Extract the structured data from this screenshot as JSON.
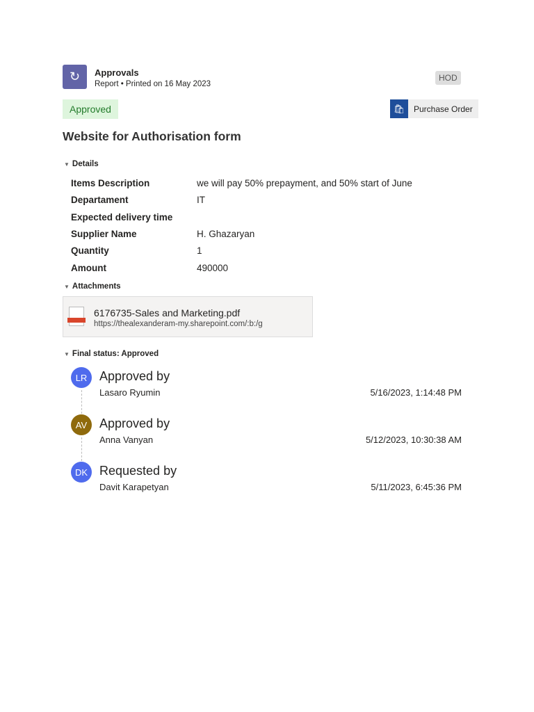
{
  "header": {
    "app_title": "Approvals",
    "subtitle": "Report • Printed on 16 May 2023",
    "tag": "HOD",
    "status": "Approved",
    "template": "Purchase Order"
  },
  "title": "Website for Authorisation form",
  "details": {
    "heading": "Details",
    "rows": [
      {
        "label": "Items Description",
        "value": "we will pay 50% prepayment, and 50% start of June"
      },
      {
        "label": "Departament",
        "value": "IT"
      },
      {
        "label": "Expected delivery time",
        "value": ""
      },
      {
        "label": "Supplier Name",
        "value": "H. Ghazaryan"
      },
      {
        "label": "Quantity",
        "value": "1"
      },
      {
        "label": "Amount",
        "value": "490000"
      }
    ]
  },
  "attachments": {
    "heading": "Attachments",
    "file": {
      "name": "6176735-Sales and Marketing.pdf",
      "url": "https://thealexanderam-my.sharepoint.com/:b:/g"
    }
  },
  "final": {
    "heading": "Final status: Approved",
    "steps": [
      {
        "initials": "LR",
        "color": "#4f6bed",
        "action": "Approved by",
        "name": "Lasaro Ryumin",
        "time": "5/16/2023, 1:14:48 PM"
      },
      {
        "initials": "AV",
        "color": "#8f6a0c",
        "action": "Approved by",
        "name": "Anna Vanyan",
        "time": "5/12/2023, 10:30:38 AM"
      },
      {
        "initials": "DK",
        "color": "#4f6bed",
        "action": "Requested by",
        "name": "Davit Karapetyan",
        "time": "5/11/2023, 6:45:36 PM"
      }
    ]
  }
}
